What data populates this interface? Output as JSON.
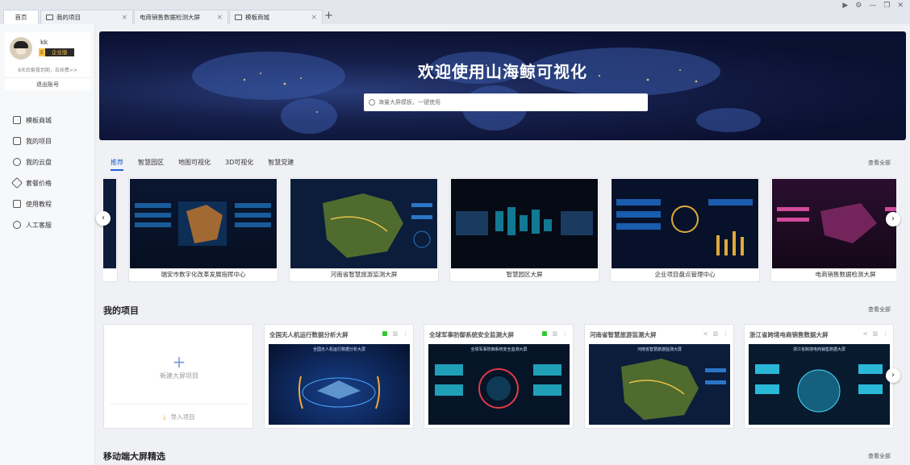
{
  "tabs": [
    {
      "label": "首页"
    },
    {
      "label": "我的项目"
    },
    {
      "label": "电商销售数据检测大屏"
    },
    {
      "label": "模板商城"
    }
  ],
  "tab_close": "×",
  "tab_add": "+",
  "window_controls": [
    "▶",
    "⚙",
    "—",
    "❐",
    "✕"
  ],
  "user": {
    "name": "kk",
    "badge_letter": "E",
    "badge_text": "企业版",
    "expire_text": "8天后套餐到期，去续费>>",
    "logout": "退出账号"
  },
  "nav": [
    {
      "label": "模板商城",
      "icon": "template-icon"
    },
    {
      "label": "我的项目",
      "icon": "chart-icon"
    },
    {
      "label": "我的云盘",
      "icon": "cloud-icon"
    },
    {
      "label": "套餐价格",
      "icon": "tag-icon"
    },
    {
      "label": "使用教程",
      "icon": "book-icon"
    },
    {
      "label": "人工客服",
      "icon": "user-icon"
    }
  ],
  "banner": {
    "title": "欢迎使用山海鲸可视化",
    "search_placeholder": "海量大屏模板，一键使用"
  },
  "categories": [
    "推荐",
    "智慧园区",
    "地图可视化",
    "3D可视化",
    "智慧党建"
  ],
  "view_all": "查看全部",
  "templates": [
    {
      "label": "瑞安市数字化改革发展指挥中心"
    },
    {
      "label": "河南省智慧旅游监测大屏"
    },
    {
      "label": "智慧园区大屏"
    },
    {
      "label": "企业项目盘点管理中心"
    },
    {
      "label": "电商销售数据检测大屏"
    }
  ],
  "my_projects": {
    "title": "我的项目",
    "new_label": "新建大屏项目",
    "import_label": "导入项目",
    "items": [
      {
        "title": "全国无人机运行数据分析大屏",
        "thumb_title": "全国无人机运行数据分析大屏"
      },
      {
        "title": "全球军事防御系统安全监测大屏",
        "thumb_title": "全球军事防御系统安全监测大屏"
      },
      {
        "title": "河南省智慧旅游监测大屏",
        "thumb_title": "河南省智慧旅游监测大屏"
      },
      {
        "title": "浙江省跨境电商销售数据大屏",
        "thumb_title": "浙江省跨境电商销售数据大屏"
      }
    ]
  },
  "mobile_section": {
    "title": "移动端大屏精选"
  },
  "arrows": {
    "left": "‹",
    "right": "›"
  }
}
